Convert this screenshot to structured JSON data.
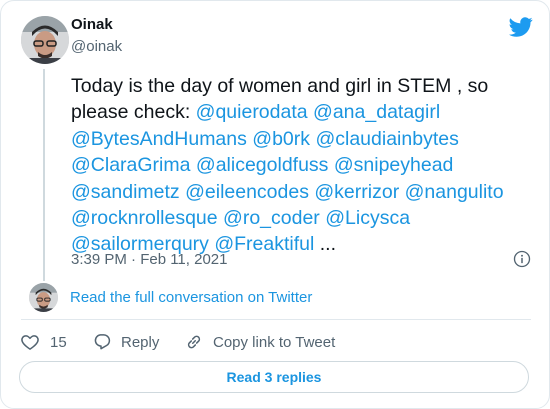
{
  "author": {
    "name": "Oinak",
    "handle": "@oinak"
  },
  "tweet": {
    "intro": "Today is the day of women and girl in STEM , so\nplease check: ",
    "mentions": [
      "@quierodata",
      "@ana_datagirl",
      "@BytesAndHumans",
      "@b0rk",
      "@claudiainbytes",
      "@ClaraGrima",
      "@alicegoldfuss",
      "@snipeyhead",
      "@sandimetz",
      "@eileencodes",
      "@kerrizor",
      "@nangulito",
      "@rocknrollesque",
      "@ro_coder",
      "@Licysca",
      "@sailormerqury",
      "@Freaktiful"
    ],
    "ellipsis": "...",
    "timestamp": "3:39 PM · Feb 11, 2021"
  },
  "conversation_link": "Read the full conversation on Twitter",
  "actions": {
    "like_count": "15",
    "reply_label": "Reply",
    "copy_label": "Copy link to Tweet"
  },
  "read_replies_label": "Read 3 replies",
  "colors": {
    "link": "#1b95e0",
    "text": "#0f1419",
    "muted": "#536471",
    "border": "#e1e8ed",
    "brand": "#1d9bf0"
  }
}
